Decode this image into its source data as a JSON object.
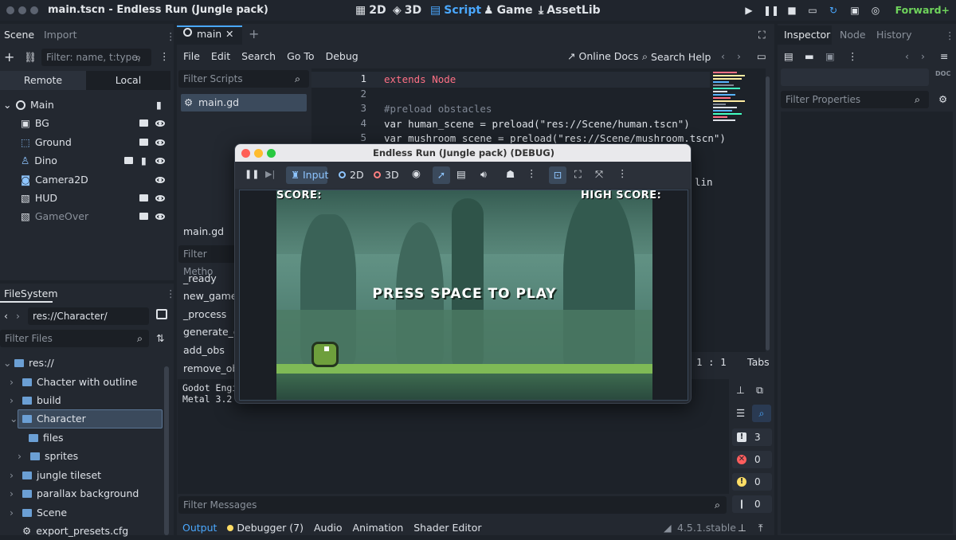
{
  "window": {
    "title": "main.tscn - Endless Run (Jungle pack)"
  },
  "workspaces": [
    {
      "label": "2D",
      "icon": "2d-icon"
    },
    {
      "label": "3D",
      "icon": "3d-icon"
    },
    {
      "label": "Script",
      "icon": "script-icon",
      "active": true
    },
    {
      "label": "Game",
      "icon": "game-icon"
    },
    {
      "label": "AssetLib",
      "icon": "assetlib-icon"
    }
  ],
  "renderer": "Forward+",
  "scene_dock": {
    "tabs": [
      "Scene",
      "Import"
    ],
    "filter_placeholder": "Filter: name, t:type,",
    "mode_tabs": [
      "Remote",
      "Local"
    ],
    "nodes": [
      {
        "name": "Main",
        "icon": "node-icon"
      },
      {
        "name": "BG",
        "icon": "parallax-icon"
      },
      {
        "name": "Ground",
        "icon": "tilemap-icon"
      },
      {
        "name": "Dino",
        "icon": "character-icon"
      },
      {
        "name": "Camera2D",
        "icon": "camera-icon"
      },
      {
        "name": "HUD",
        "icon": "canvas-layer-icon"
      },
      {
        "name": "GameOver",
        "icon": "canvas-layer-icon"
      }
    ]
  },
  "filesystem": {
    "title": "FileSystem",
    "path": "res://Character/",
    "filter_placeholder": "Filter Files",
    "items": [
      "res://",
      "Chacter with outline",
      "build",
      "Character",
      "files",
      "sprites",
      "jungle tileset",
      "parallax background",
      "Scene",
      "export_presets.cfg"
    ]
  },
  "editor": {
    "tab": "main",
    "menu": [
      "File",
      "Edit",
      "Search",
      "Go To",
      "Debug"
    ],
    "online_docs": "Online Docs",
    "search_help": "Search Help",
    "filter_scripts": "Filter Scripts",
    "script_item": "main.gd",
    "script_label": "main.gd",
    "filter_methods": "Filter Metho",
    "methods": [
      "_ready",
      "new_game",
      "_process",
      "generate_ob",
      "add_obs",
      "remove_obs"
    ],
    "lines": [
      {
        "n": "1",
        "text": "extends Node"
      },
      {
        "n": "2",
        "text": ""
      },
      {
        "n": "3",
        "text": "#preload obstacles"
      },
      {
        "n": "4",
        "text": "var human_scene = preload(\"res://Scene/human.tscn\")"
      },
      {
        "n": "5",
        "text": "var mushroom_scene = preload(\"res://Scene/mushroom.tscn\")"
      }
    ],
    "code_tail": "lin",
    "cursor": "1 :   1",
    "tabs_label": "Tabs"
  },
  "output": {
    "lines": [
      "Godot Engi",
      "Metal 3.2 -"
    ],
    "filter_placeholder": "Filter Messages",
    "counts": {
      "errors_all": "3",
      "errors": "0",
      "warnings": "0",
      "messages": "0"
    }
  },
  "bottom_tabs": [
    "Output",
    "Debugger (7)",
    "Audio",
    "Animation",
    "Shader Editor"
  ],
  "version": "4.5.1.stable",
  "inspector": {
    "tabs": [
      "Inspector",
      "Node",
      "History"
    ],
    "filter_placeholder": "Filter Properties"
  },
  "debug_window": {
    "title": "Endless Run (Jungle pack) (DEBUG)",
    "toolbar": {
      "input": "Input",
      "2d": "2D",
      "3d": "3D"
    },
    "game": {
      "score": "SCORE:",
      "high_score": "HIGH SCORE:",
      "prompt": "PRESS SPACE TO PLAY"
    }
  },
  "colors": {
    "accent": "#4aa8ff",
    "renderer": "#6fd45c"
  }
}
